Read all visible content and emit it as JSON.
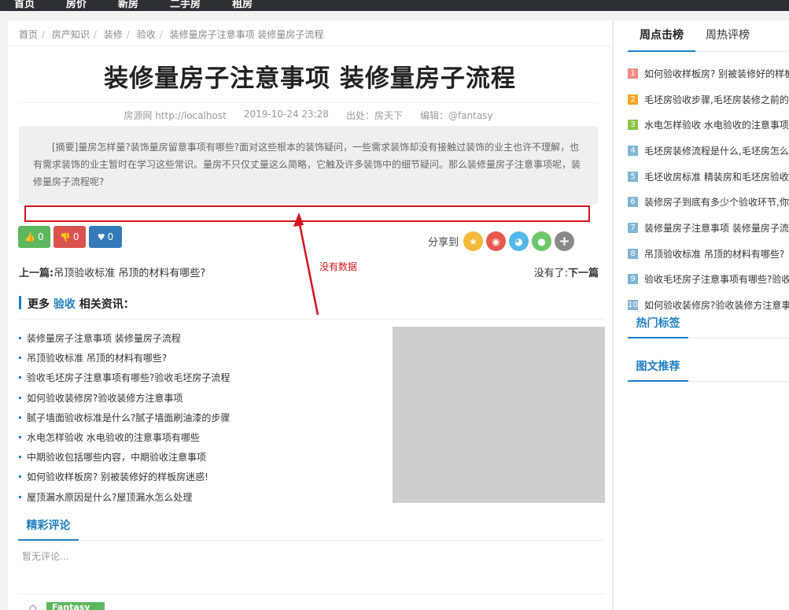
{
  "topnav": [
    "首页",
    "房价",
    "新房",
    "二手房",
    "租房"
  ],
  "breadcrumb": [
    "首页",
    "房产知识",
    "装修",
    "验收",
    "装修量房子注意事项 装修量房子流程"
  ],
  "article": {
    "title": "装修量房子注意事项 装修量房子流程",
    "meta": {
      "source": "房源网 http://localhost",
      "datetime": "2019-10-24 23:28",
      "from": "出处：房天下",
      "editor": "编辑：@fantasy"
    },
    "summary": "[摘要]量房怎样量?装饰量房留意事项有哪些?面对这些根本的装饰疑问，一些需求装饰却没有接触过装饰的业主也许不理解，也有需求装饰的业主暂时在学习这些常识。量房不只仅丈量这么简略，它触及许多装饰中的细节疑问。那么装修量房子注意事项呢，装修量房子流程呢?"
  },
  "annotation": {
    "text": "没有数据",
    "color": "#d6121d"
  },
  "votes": {
    "up": "0",
    "down": "0",
    "fav": "0"
  },
  "share": {
    "label": "分享到",
    "icons": [
      "qzone-icon",
      "weibo-icon",
      "tqq-icon",
      "wechat-icon",
      "more-icon"
    ]
  },
  "pager": {
    "prev_label": "上一篇:",
    "prev_title": "吊顶验收标准 吊顶的材料有哪些?",
    "next_prefix": "没有了:",
    "next_label": "下一篇"
  },
  "related": {
    "heading_prefix": "更多",
    "keyword": "验收",
    "heading_suffix": "相关资讯：",
    "items": [
      "装修量房子注意事项 装修量房子流程",
      "吊顶验收标准 吊顶的材料有哪些?",
      "验收毛坯房子注意事项有哪些?验收毛坯房子流程",
      "如何验收装修房?验收装修方注意事项",
      "腻子墙面验收标准是什么?腻子墙面刷油漆的步骤",
      "水电怎样验收 水电验收的注意事项有哪些",
      "中期验收包括哪些内容，中期验收注意事项",
      "如何验收样板房? 别被装修好的样板房迷惑!",
      "屋顶漏水原因是什么?屋顶漏水怎么处理"
    ]
  },
  "comments": {
    "title": "精彩评论",
    "empty": "暂无评论...",
    "author": "Fantasy"
  },
  "sidebar": {
    "tabs": [
      "周点击榜",
      "周热评榜"
    ],
    "hot": [
      {
        "n": "1",
        "title": "如何验收样板房? 别被装修好的样板房迷惑!",
        "color": "#f08a84"
      },
      {
        "n": "2",
        "title": "毛坯房验收步骤,毛坯房装修之前的注意事项",
        "color": "#f6a623"
      },
      {
        "n": "3",
        "title": "水电怎样验收 水电验收的注意事项有哪些",
        "color": "#8bc34a"
      },
      {
        "n": "4",
        "title": "毛坯房装修流程是什么,毛坯房怎么验收",
        "color": "#7fb5d6"
      },
      {
        "n": "5",
        "title": "毛坯收房标准 精装房和毛坯房验收区别",
        "color": "#7fb5d6"
      },
      {
        "n": "6",
        "title": "装修房子到底有多少个验收环节,你知道吗",
        "color": "#7fb5d6"
      },
      {
        "n": "7",
        "title": "装修量房子注意事项 装修量房子流程",
        "color": "#7fb5d6"
      },
      {
        "n": "8",
        "title": "吊顶验收标准 吊顶的材料有哪些?",
        "color": "#7fb5d6"
      },
      {
        "n": "9",
        "title": "验收毛坯房子注意事项有哪些?验收毛坯房子流程",
        "color": "#7fb5d6"
      },
      {
        "n": "10",
        "title": "如何验收装修房?验收装修方注意事项",
        "color": "#7fb5d6"
      }
    ],
    "hot_tags_title": "热门标签",
    "image_rec_title": "图文推荐"
  }
}
